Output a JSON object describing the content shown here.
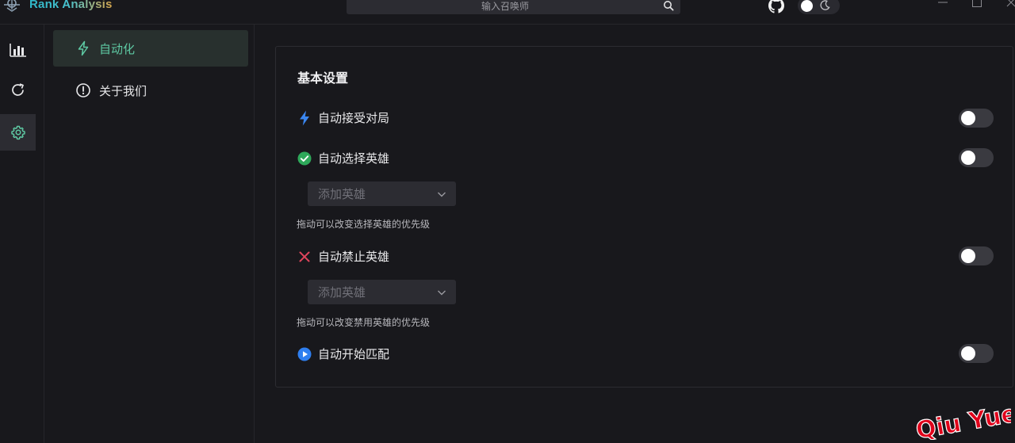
{
  "app": {
    "title": "Rank Analysis",
    "watermark": "Qiu Yue"
  },
  "search": {
    "placeholder": "输入召唤师"
  },
  "nav": {
    "items": [
      {
        "label": "自动化",
        "icon": "lightning-icon"
      },
      {
        "label": "关于我们",
        "icon": "info-circle-icon"
      }
    ]
  },
  "settings": {
    "title": "基本设置",
    "auto_accept": {
      "label": "自动接受对局",
      "enabled": false
    },
    "auto_pick": {
      "label": "自动选择英雄",
      "enabled": false,
      "select_placeholder": "添加英雄",
      "hint": "拖动可以改变选择英雄的优先级"
    },
    "auto_ban": {
      "label": "自动禁止英雄",
      "enabled": false,
      "select_placeholder": "添加英雄",
      "hint": "拖动可以改变禁用英雄的优先级"
    },
    "auto_match": {
      "label": "自动开始匹配",
      "enabled": false
    }
  },
  "colors": {
    "accent_green": "#5ec9a3",
    "bolt_blue": "#3a86f0",
    "check_green": "#2ea85a",
    "cross_red": "#e0455c",
    "play_blue": "#2f7ff0"
  }
}
